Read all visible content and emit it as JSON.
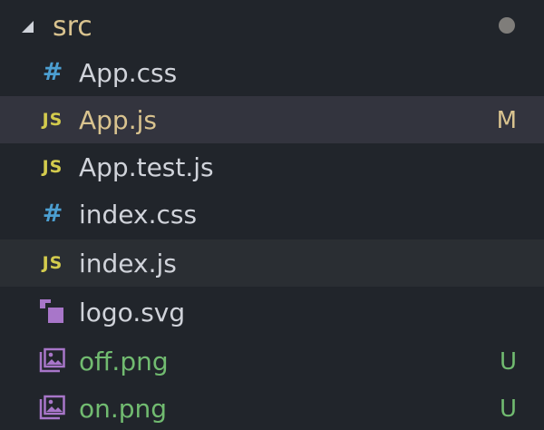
{
  "explorer": {
    "folder": {
      "name": "src",
      "expanded": true,
      "has_modified_indicator": true
    },
    "colors": {
      "background": "#21252b",
      "selected_row": "#33343e",
      "hover_row": "#2a2e33",
      "modified": "#d9c38f",
      "untracked": "#71bb70",
      "css_icon": "#4c9fd1",
      "js_icon": "#d3cb4d",
      "svg_icon": "#a876c9",
      "image_icon": "#a876c9"
    },
    "files": [
      {
        "name": "App.css",
        "icon": "css-icon",
        "icon_text": "#",
        "status": "",
        "state": "normal"
      },
      {
        "name": "App.js",
        "icon": "js-icon",
        "icon_text": "JS",
        "status": "M",
        "state": "modified",
        "selected": true
      },
      {
        "name": "App.test.js",
        "icon": "js-icon",
        "icon_text": "JS",
        "status": "",
        "state": "normal"
      },
      {
        "name": "index.css",
        "icon": "css-icon",
        "icon_text": "#",
        "status": "",
        "state": "normal"
      },
      {
        "name": "index.js",
        "icon": "js-icon",
        "icon_text": "JS",
        "status": "",
        "state": "normal",
        "hovered": true
      },
      {
        "name": "logo.svg",
        "icon": "svg-icon",
        "icon_text": "",
        "status": "",
        "state": "normal"
      },
      {
        "name": "off.png",
        "icon": "image-icon",
        "icon_text": "",
        "status": "U",
        "state": "untracked"
      },
      {
        "name": "on.png",
        "icon": "image-icon",
        "icon_text": "",
        "status": "U",
        "state": "untracked"
      }
    ]
  }
}
